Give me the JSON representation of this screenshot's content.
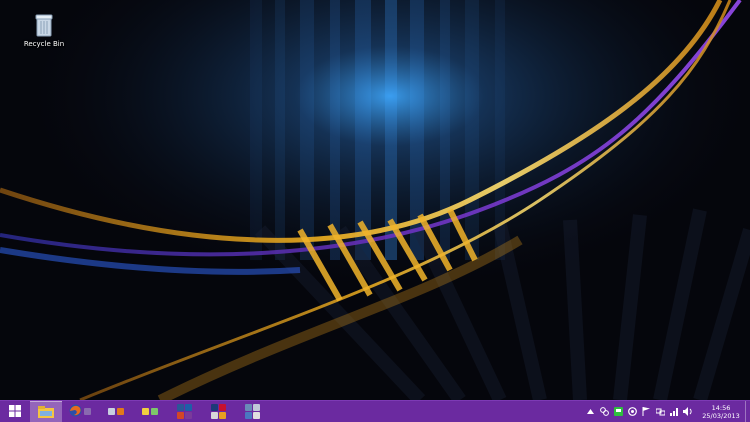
{
  "desktop": {
    "icons": [
      {
        "label": "Recycle Bin",
        "icon": "recycle-bin-icon"
      }
    ]
  },
  "taskbar": {
    "color": "#6b2aa0",
    "start_icon": "windows-logo-icon",
    "pinned": [
      {
        "name": "file-explorer-icon",
        "active": true
      },
      {
        "name": "firefox-icon",
        "active": false
      },
      {
        "name": "utility-group-icons",
        "active": false
      },
      {
        "name": "tools-group-icons",
        "active": false
      },
      {
        "name": "office-group-icons",
        "active": false
      },
      {
        "name": "adobe-group-icons",
        "active": false
      },
      {
        "name": "system-group-icons",
        "active": false
      }
    ],
    "tray": {
      "icons": [
        "chevron-up-icon",
        "network-tray-icon",
        "green-tray-icon",
        "circle-tray-icon",
        "flag-icon",
        "network-icon",
        "signal-icon",
        "volume-icon"
      ],
      "time": "14:56",
      "date": "25/03/2013"
    }
  }
}
